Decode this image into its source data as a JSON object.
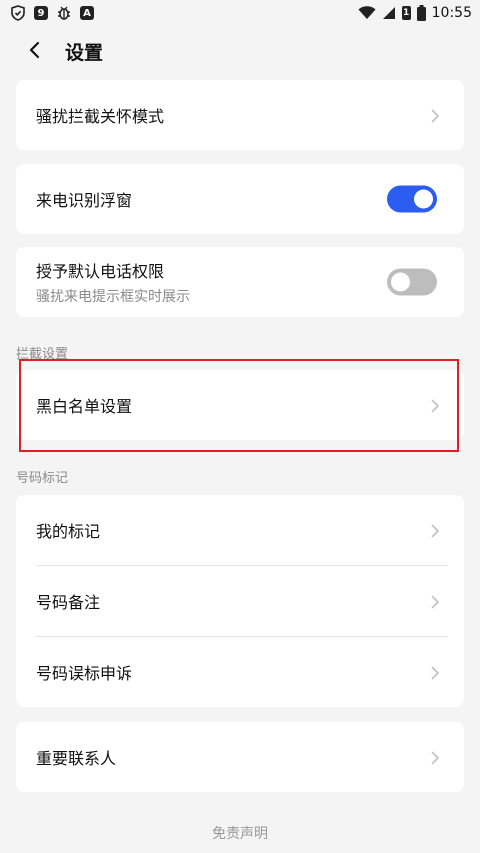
{
  "status_bar": {
    "time": "10:55",
    "left_icons": [
      "shield-check-icon",
      "badge-9-icon",
      "bug-icon",
      "a-box-icon"
    ],
    "right_icons": [
      "wifi-icon",
      "signal-icon",
      "sim-1-icon",
      "battery-icon"
    ],
    "badge_9": "9",
    "badge_a": "A",
    "sim_label": "1"
  },
  "header": {
    "title": "设置"
  },
  "items": {
    "harassment_care": {
      "label": "骚扰拦截关怀模式"
    },
    "caller_float": {
      "label": "来电识别浮窗",
      "toggle": "on"
    },
    "default_phone": {
      "label": "授予默认电话权限",
      "sublabel": "骚扰来电提示框实时展示",
      "toggle": "off"
    },
    "blacklist": {
      "label": "黑白名单设置"
    },
    "my_marks": {
      "label": "我的标记"
    },
    "number_notes": {
      "label": "号码备注"
    },
    "mislabel_appeal": {
      "label": "号码误标申诉"
    },
    "important_contacts": {
      "label": "重要联系人"
    }
  },
  "sections": {
    "intercept": "拦截设置",
    "number_marks": "号码标记"
  },
  "footer": {
    "disclaimer": "免责声明"
  },
  "colors": {
    "toggle_on": "#2a5df0",
    "toggle_off": "#bdbdbd",
    "highlight": "#e02020",
    "background": "#f4f4f4"
  }
}
